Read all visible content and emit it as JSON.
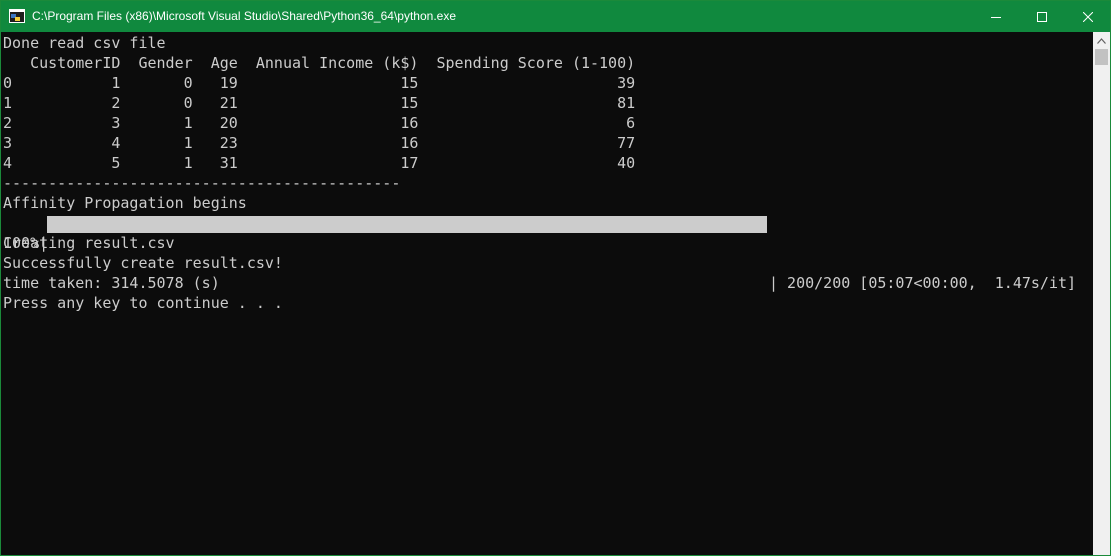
{
  "window": {
    "title": "C:\\Program Files (x86)\\Microsoft Visual Studio\\Shared\\Python36_64\\python.exe",
    "accent_color": "#10893e",
    "icons": {
      "app": "python-console-icon",
      "minimize": "minimize-icon",
      "maximize": "maximize-icon",
      "close": "close-icon"
    }
  },
  "console": {
    "lines": [
      "Done read csv file",
      "   CustomerID  Gender  Age  Annual Income (k$)  Spending Score (1-100)",
      "0           1       0   19                  15                      39",
      "1           2       0   21                  15                      81",
      "2           3       1   20                  16                       6",
      "3           4       1   23                  16                      77",
      "4           5       1   31                  17                      40",
      "--------------------------------------------",
      "Affinity Propagation begins"
    ],
    "progress": {
      "prefix": "100%|",
      "suffix": "| 200/200 [05:07<00:00,  1.47s/it]",
      "fraction": 1.0
    },
    "after_lines": [
      "Creating result.csv",
      "Successfully create result.csv!",
      "time taken: 314.5078 (s)",
      "Press any key to continue . . ."
    ]
  }
}
